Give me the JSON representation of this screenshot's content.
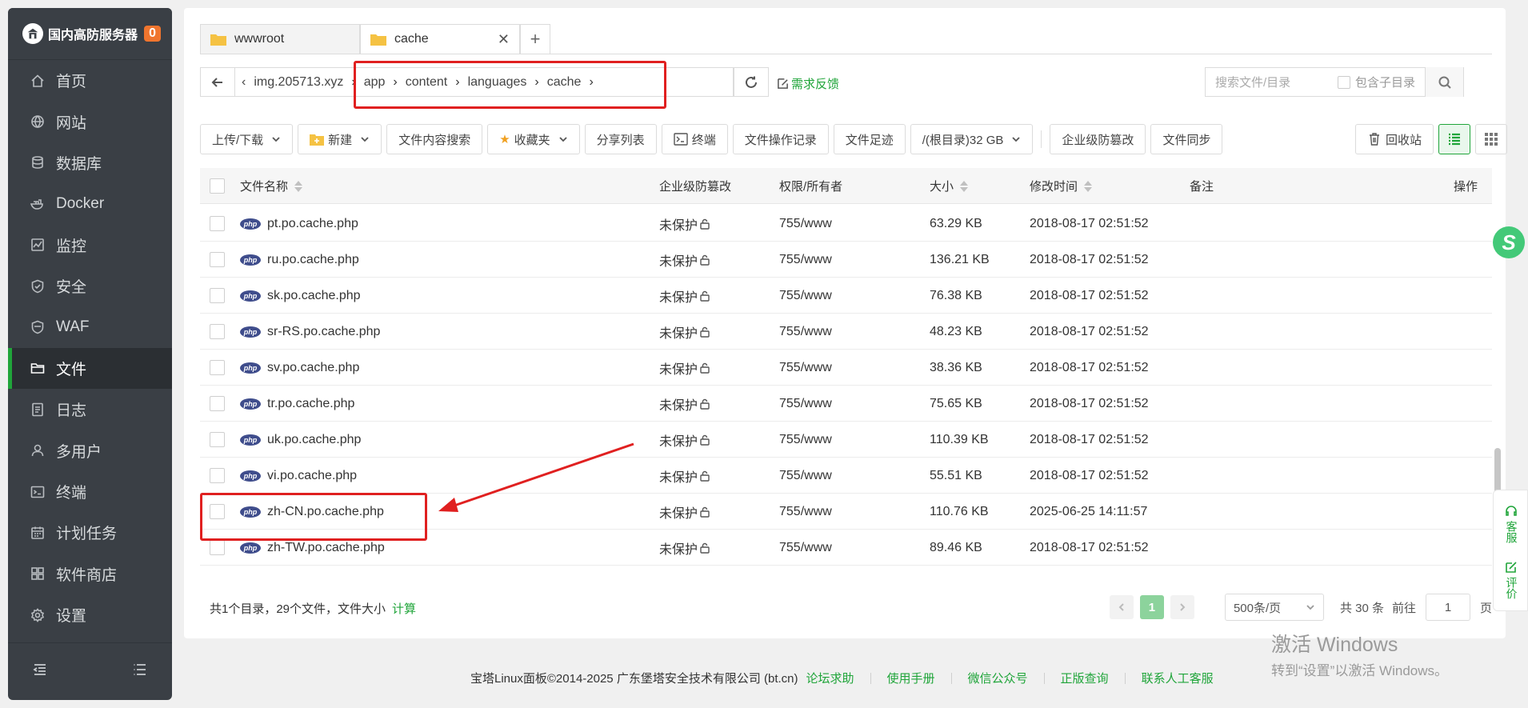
{
  "brand": {
    "title": "国内高防服务器",
    "badge": "0"
  },
  "sidebar": {
    "items": [
      {
        "label": "首页",
        "icon": "home-icon"
      },
      {
        "label": "网站",
        "icon": "globe-icon"
      },
      {
        "label": "数据库",
        "icon": "database-icon"
      },
      {
        "label": "Docker",
        "icon": "docker-icon"
      },
      {
        "label": "监控",
        "icon": "monitor-icon"
      },
      {
        "label": "安全",
        "icon": "shield-icon"
      },
      {
        "label": "WAF",
        "icon": "waf-icon"
      },
      {
        "label": "文件",
        "icon": "folder-icon",
        "active": true
      },
      {
        "label": "日志",
        "icon": "log-icon"
      },
      {
        "label": "多用户",
        "icon": "users-icon"
      },
      {
        "label": "终端",
        "icon": "terminal-icon"
      },
      {
        "label": "计划任务",
        "icon": "calendar-icon"
      },
      {
        "label": "软件商店",
        "icon": "apps-icon"
      },
      {
        "label": "设置",
        "icon": "gear-icon"
      }
    ]
  },
  "tabs": [
    {
      "label": "wwwroot"
    },
    {
      "label": "cache",
      "active": true
    }
  ],
  "path": {
    "root": "img.205713.xyz",
    "segments": [
      "app",
      "content",
      "languages",
      "cache"
    ]
  },
  "feedback_label": "需求反馈",
  "search": {
    "placeholder": "搜索文件/目录",
    "subdir_label": "包含子目录"
  },
  "toolbar": {
    "upload": "上传/下载",
    "create": "新建",
    "content_search": "文件内容搜索",
    "favorites": "收藏夹",
    "share": "分享列表",
    "terminal": "终端",
    "op_log": "文件操作记录",
    "footprint": "文件足迹",
    "disk": "/(根目录)32 GB",
    "tamper": "企业级防篡改",
    "sync": "文件同步",
    "recycle": "回收站"
  },
  "table": {
    "headers": {
      "name": "文件名称",
      "tamper": "企业级防篡改",
      "perm": "权限/所有者",
      "size": "大小",
      "mtime": "修改时间",
      "note": "备注",
      "ops": "操作"
    },
    "rows": [
      {
        "name": "pt.po.cache.php",
        "tamper": "未保护",
        "perm": "755/www",
        "size": "63.29 KB",
        "mtime": "2018-08-17 02:51:52"
      },
      {
        "name": "ru.po.cache.php",
        "tamper": "未保护",
        "perm": "755/www",
        "size": "136.21 KB",
        "mtime": "2018-08-17 02:51:52"
      },
      {
        "name": "sk.po.cache.php",
        "tamper": "未保护",
        "perm": "755/www",
        "size": "76.38 KB",
        "mtime": "2018-08-17 02:51:52"
      },
      {
        "name": "sr-RS.po.cache.php",
        "tamper": "未保护",
        "perm": "755/www",
        "size": "48.23 KB",
        "mtime": "2018-08-17 02:51:52"
      },
      {
        "name": "sv.po.cache.php",
        "tamper": "未保护",
        "perm": "755/www",
        "size": "38.36 KB",
        "mtime": "2018-08-17 02:51:52"
      },
      {
        "name": "tr.po.cache.php",
        "tamper": "未保护",
        "perm": "755/www",
        "size": "75.65 KB",
        "mtime": "2018-08-17 02:51:52"
      },
      {
        "name": "uk.po.cache.php",
        "tamper": "未保护",
        "perm": "755/www",
        "size": "110.39 KB",
        "mtime": "2018-08-17 02:51:52"
      },
      {
        "name": "vi.po.cache.php",
        "tamper": "未保护",
        "perm": "755/www",
        "size": "55.51 KB",
        "mtime": "2018-08-17 02:51:52"
      },
      {
        "name": "zh-CN.po.cache.php",
        "tamper": "未保护",
        "perm": "755/www",
        "size": "110.76 KB",
        "mtime": "2025-06-25 14:11:57"
      },
      {
        "name": "zh-TW.po.cache.php",
        "tamper": "未保护",
        "perm": "755/www",
        "size": "89.46 KB",
        "mtime": "2018-08-17 02:51:52"
      }
    ]
  },
  "file_icon_text": "php",
  "footer": {
    "summary": "共1个目录，29个文件，文件大小",
    "calc": "计算",
    "page": "1",
    "page_size": "500条/页",
    "total": "共 30 条",
    "goto": "前往",
    "goto_value": "1",
    "page_unit": "页"
  },
  "floating": {
    "service": "客服",
    "review": "评价"
  },
  "watermark": {
    "line1": "激活 Windows",
    "line2": "转到“设置”以激活 Windows。"
  },
  "page_footer": {
    "copyright": "宝塔Linux面板©2014-2025 广东堡塔安全技术有限公司 (bt.cn)",
    "links": [
      "论坛求助",
      "使用手册",
      "微信公众号",
      "正版查询",
      "联系人工客服"
    ]
  },
  "colors": {
    "accent": "#20a53a",
    "sidebar_bg": "#3a3f45",
    "highlight_red": "#e02020",
    "badge": "#f0752e"
  }
}
